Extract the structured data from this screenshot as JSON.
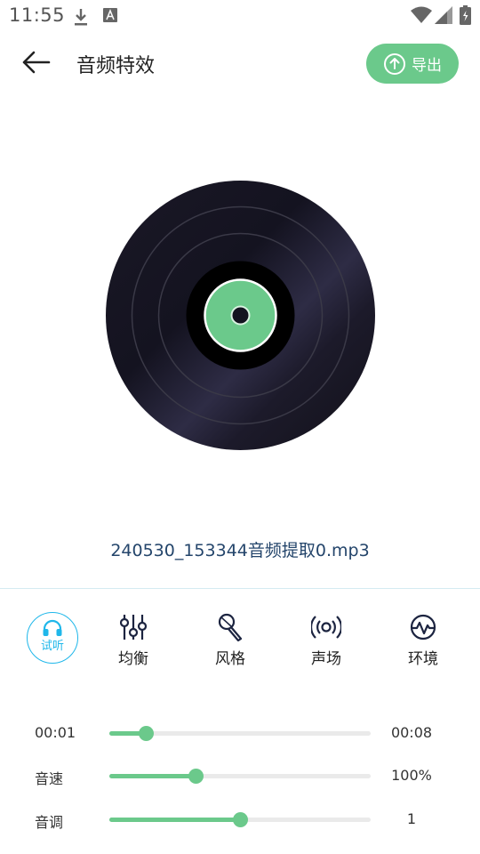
{
  "status_bar": {
    "time": "11:55"
  },
  "header": {
    "title": "音频特效",
    "export_label": "导出"
  },
  "file": {
    "name": "240530_153344音频提取0.mp3"
  },
  "tabs": [
    {
      "label": "试听",
      "icon": "headphones-icon",
      "active": true
    },
    {
      "label": "均衡",
      "icon": "equalizer-icon"
    },
    {
      "label": "风格",
      "icon": "microphone-icon"
    },
    {
      "label": "声场",
      "icon": "broadcast-icon"
    },
    {
      "label": "环境",
      "icon": "pulse-icon"
    }
  ],
  "controls": {
    "progress": {
      "current": "00:01",
      "total": "00:08",
      "value": 0.14
    },
    "speed": {
      "label": "音速",
      "value_text": "100%",
      "value": 0.33
    },
    "pitch": {
      "label": "音调",
      "value_text": "1",
      "value": 0.5
    }
  },
  "colors": {
    "accent": "#6bc98b",
    "active_tab": "#1fb7ea",
    "filename": "#24456b"
  }
}
